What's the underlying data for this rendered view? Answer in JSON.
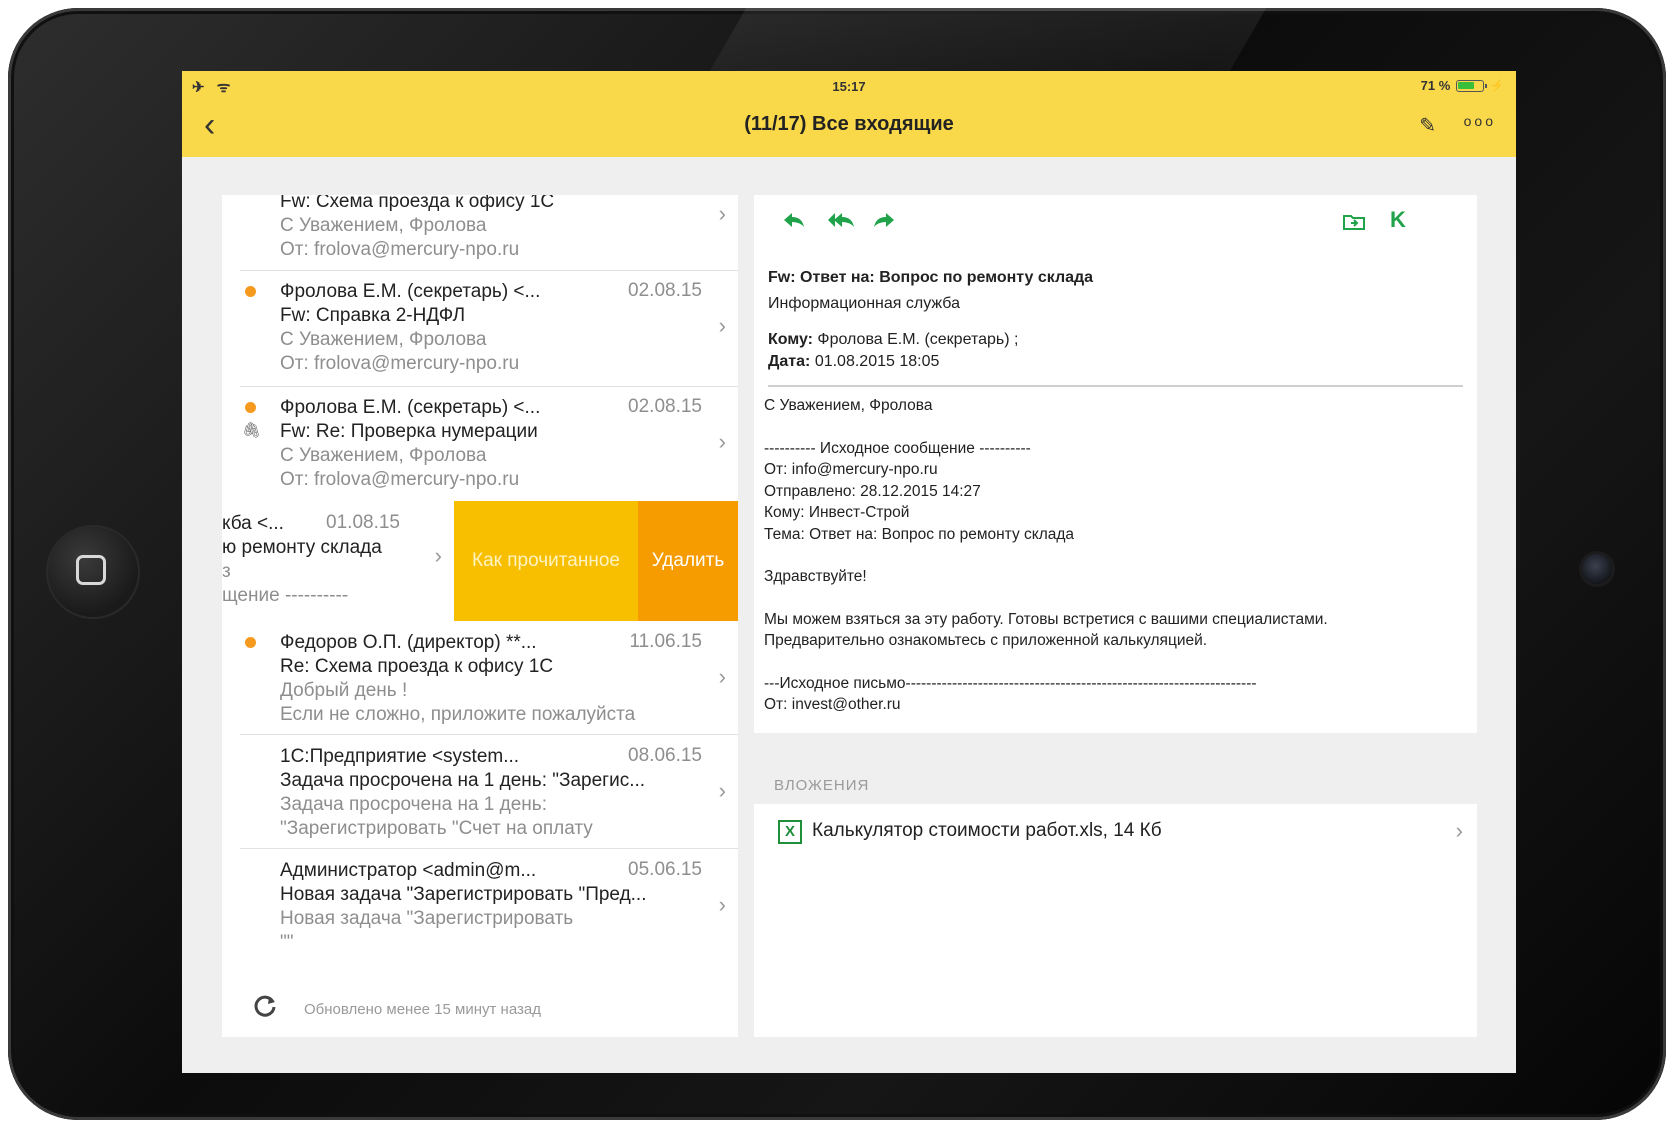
{
  "status_bar": {
    "icons": "✈ ᯤ",
    "time": "15:17",
    "battery": "71 %",
    "battery_level": 0.71
  },
  "navbar": {
    "back_icon": "‹",
    "title": "(11/17) Все входящие",
    "edit_icon": "✎",
    "more_icon": "ooo"
  },
  "messages": [
    {
      "sender": "",
      "date": "",
      "subject": "Fw: Схема проезда к офису 1С",
      "preview1": "С Уважением, Фролова",
      "preview2": "От: frolova@mercury-npo.ru",
      "unread": false,
      "attachment": false
    },
    {
      "sender": "Фролова Е.М. (секретарь) <...",
      "date": "02.08.15",
      "subject": "Fw: Справка 2-НДФЛ",
      "preview1": "С Уважением, Фролова",
      "preview2": "От: frolova@mercury-npo.ru",
      "unread": true,
      "attachment": false
    },
    {
      "sender": "Фролова Е.М. (секретарь) <...",
      "date": "02.08.15",
      "subject": "Fw: Re: Проверка нумерации",
      "preview1": "С Уважением, Фролова",
      "preview2": "От: frolova@mercury-npo.ru",
      "unread": true,
      "attachment": true
    },
    {
      "sender": "кба <...",
      "date": "01.08.15",
      "subject": "ю ремонту склада",
      "preview1": "з",
      "preview2": "щение ----------",
      "unread": false,
      "attachment": false
    },
    {
      "sender": "Федоров О.П. (директор) **...",
      "date": "11.06.15",
      "subject": "Re: Схема проезда к офису 1С",
      "preview1": "Добрый день !",
      "preview2": "Если не сложно, приложите пожалуйста",
      "unread": true,
      "attachment": false
    },
    {
      "sender": "1С:Предприятие <system...",
      "date": "08.06.15",
      "subject": "Задача просрочена на 1 день: \"Зарегис...",
      "preview1": "Задача просрочена на 1 день:",
      "preview2": "\"Зарегистрировать \"Счет на оплату",
      "unread": false,
      "attachment": false
    },
    {
      "sender": "Администратор <admin@m...",
      "date": "05.06.15",
      "subject": "Новая задача \"Зарегистрировать \"Пред...",
      "preview1": "Новая задача \"Зарегистрировать",
      "preview2": "\"\"",
      "unread": false,
      "attachment": false
    }
  ],
  "swipe_actions": {
    "mark_read": "Как прочитанное",
    "delete": "Удалить"
  },
  "list_footer": {
    "refresh_icon": "C",
    "text": "Обновлено менее 15 минут назад"
  },
  "toolbar": {
    "reply_icon": "🡰",
    "reply_all_icon": "«",
    "forward_icon": "🡲",
    "move_icon": "folder-icon",
    "k_label": "K"
  },
  "mail": {
    "subject": "Fw: Ответ на: Вопрос по ремонту склада",
    "from": "Информационная служба",
    "to_label": "Кому:",
    "to_value": "Фролова Е.М. (секретарь) ;",
    "date_label": "Дата:",
    "date_value": "01.08.2015 18:05",
    "body": [
      "С Уважением, Фролова",
      "",
      "---------- Исходное сообщение ----------",
      "От: info@mercury-npo.ru",
      "Отправлено: 28.12.2015 14:27",
      "Кому: Инвест-Строй",
      "Тема: Ответ на: Вопрос по ремонту склада",
      "",
      "Здравствуйте!",
      "",
      "Мы можем взяться за эту работу. Готовы встретися с вашими специалистами.",
      "Предварительно ознакомьтесь с приложенной калькуляцией.",
      "",
      "---Исходное письмо--------------------------------------------------------------------",
      "От: invest@other.ru"
    ]
  },
  "attachments": {
    "label": "ВЛОЖЕНИЯ",
    "items": [
      {
        "icon": "X",
        "name": "Калькулятор стоимости работ.xls, 14 Кб",
        "chevron": "›"
      }
    ]
  },
  "colors": {
    "header": "#f9d84a",
    "accent_green": "#20a34a",
    "unread_dot": "#f59a1f",
    "swipe_read": "#f7bf00",
    "swipe_delete": "#f69b00"
  }
}
